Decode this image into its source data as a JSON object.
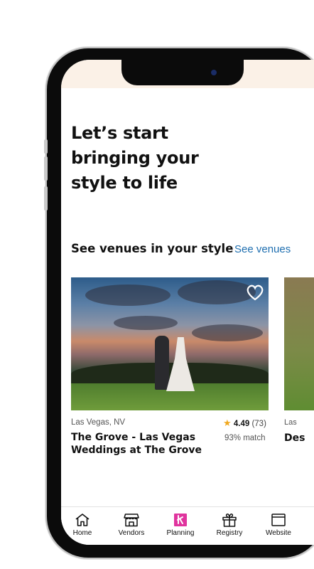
{
  "hero": {
    "title": "Let’s start bringing your style to life"
  },
  "section": {
    "heading": "See venues in your style",
    "link": "See venues"
  },
  "card": {
    "location": "Las Vegas, NV",
    "name": "The Grove - Las Vegas Weddings at The Grove",
    "rating": "4.49",
    "reviews": "(73)",
    "match": "93% match"
  },
  "next_card": {
    "location": "Las",
    "name": "Des"
  },
  "tabs": [
    {
      "label": "Home",
      "icon": "home-icon"
    },
    {
      "label": "Vendors",
      "icon": "storefront-icon"
    },
    {
      "label": "Planning",
      "icon": "planning-icon"
    },
    {
      "label": "Registry",
      "icon": "gift-icon"
    },
    {
      "label": "Website",
      "icon": "browser-icon"
    }
  ],
  "colors": {
    "accent": "#1f6fb0",
    "planning": "#e0349e",
    "star": "#f0a81e",
    "status_bar": "#fbf1e7"
  }
}
